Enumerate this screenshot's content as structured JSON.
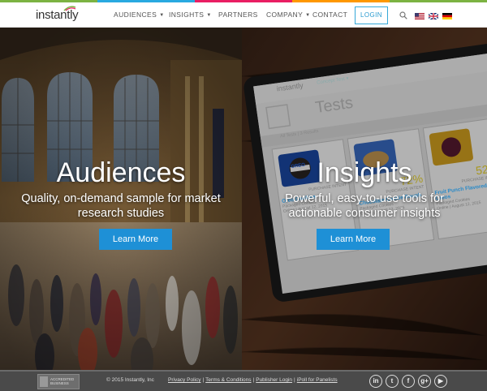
{
  "brand": {
    "logo_text": "instantly",
    "stripe_colors": [
      "#7cb342",
      "#29a9e0",
      "#e91e63",
      "#ff9800",
      "#7cb342"
    ]
  },
  "nav": {
    "items": [
      {
        "label": "AUDIENCES",
        "has_caret": true
      },
      {
        "label": "INSIGHTS",
        "has_caret": true
      },
      {
        "label": "PARTNERS",
        "has_caret": false
      },
      {
        "label": "COMPANY",
        "has_caret": true
      },
      {
        "label": "CONTACT",
        "has_caret": false
      }
    ],
    "caret_glyph": "▼",
    "login_label": "LOGIN",
    "search_icon": "search-icon",
    "flags": [
      "flag-us-icon",
      "flag-uk-icon",
      "flag-de-icon"
    ]
  },
  "hero": {
    "audiences": {
      "title": "Audiences",
      "subtitle": "Quality, on-demand sample for market research studies",
      "button": "Learn More"
    },
    "insights": {
      "title": "Insights",
      "subtitle": "Powerful, easy-to-use tools for actionable consumer insights",
      "button": "Learn More"
    },
    "tablet": {
      "logo": "instantly",
      "menu": "Concept Test ▾",
      "heading": "Tests",
      "results": "All Tests | 3 Results",
      "cards": [
        {
          "brand": "OREO",
          "percent": "",
          "caption": "PURCHASE INTENT",
          "name": "Oreo Cookies"
        },
        {
          "brand": "",
          "percent": "72%",
          "caption": "PURCHASE INTENT",
          "name": "Chocolate Cookie Dough"
        },
        {
          "brand": "",
          "percent": "52%",
          "caption": "PURCHASE INTENT",
          "name": "Fruit Punch Flavored Oreos"
        }
      ],
      "card_meta": [
        "Packaged Cookies",
        "Online | August 12, 2015"
      ]
    }
  },
  "footer": {
    "bbb_lines": [
      "ACCREDITED",
      "BUSINESS"
    ],
    "copyright": "© 2015 Instantly, Inc",
    "links": [
      "Privacy Policy",
      "Terms & Conditions",
      "Publisher Login",
      "iPoll for Panelists"
    ],
    "separator": "|",
    "social": [
      {
        "name": "linkedin-icon",
        "glyph": "in"
      },
      {
        "name": "twitter-icon",
        "glyph": "t"
      },
      {
        "name": "facebook-icon",
        "glyph": "f"
      },
      {
        "name": "googleplus-icon",
        "glyph": "g+"
      },
      {
        "name": "youtube-icon",
        "glyph": "▶"
      }
    ]
  }
}
